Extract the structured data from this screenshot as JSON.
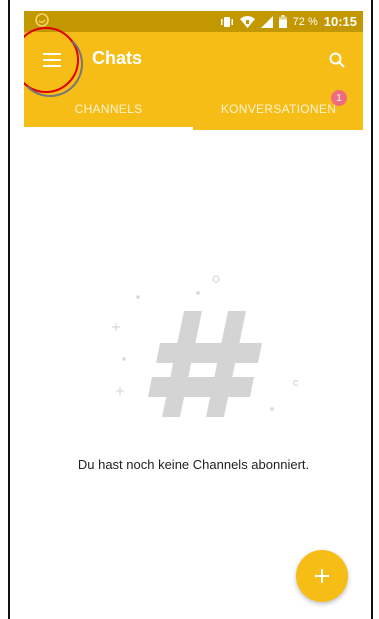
{
  "statusbar": {
    "battery_percent": "72 %",
    "clock": "10:15",
    "icons": [
      "assistant-icon",
      "vibrate-icon",
      "wifi-icon",
      "signal-icon",
      "battery-icon"
    ]
  },
  "appbar": {
    "title": "Chats",
    "menu_icon": "hamburger-menu-icon",
    "search_icon": "search-icon"
  },
  "tabs": [
    {
      "label": "CHANNELS",
      "selected": true
    },
    {
      "label": "KONVERSATIONEN",
      "selected": false,
      "badge": "1"
    }
  ],
  "empty_state": {
    "icon": "hashtag-icon",
    "message": "Du hast noch keine Channels abonniert."
  },
  "fab": {
    "icon": "plus-icon"
  },
  "colors": {
    "accent": "#f6bd17",
    "statusbar": "#c29700",
    "badge": "#ef6b7d",
    "illustration": "#d9d9d9",
    "annotation": "#e00000"
  }
}
